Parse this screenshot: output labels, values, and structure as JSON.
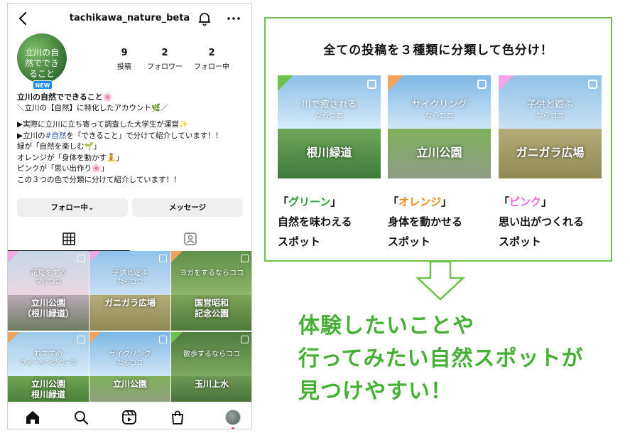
{
  "profile": {
    "username": "tachikawa_nature_beta",
    "avatar_text": "立川の自然でできること",
    "new_badge": "NEW",
    "stats": [
      {
        "num": "9",
        "label": "投稿"
      },
      {
        "num": "2",
        "label": "フォロワー"
      },
      {
        "num": "2",
        "label": "フォロー中"
      }
    ],
    "bio": {
      "name": "立川の自然でできること🌸",
      "line1": "＼立川の【自然】に特化したアカウント🌿／",
      "line2": "▶実際に立川に立ち寄って調査した大学生が運営✨",
      "line3_pre": "▶立川の",
      "line3_hash": "#自然",
      "line3_post": "を「できること」で分けて紹介しています！！",
      "line4": "緑が「自然を楽しむ🌱」",
      "line5": "オレンジが「身体を動かす🧘」",
      "line6": "ピンクが「思い出作り🌸」",
      "line7": "この３つの色で分類に分けて紹介しています！！"
    },
    "follow_button": "フォロー中⌄",
    "message_button": "メッセージ"
  },
  "posts": [
    {
      "title": "花見をする",
      "sub": "ならココ",
      "place": "立川公園",
      "place2": "（根川緑道）",
      "tag": "pink"
    },
    {
      "title": "子供と遊ぶ",
      "sub": "ならココ",
      "place": "ガニガラ広場",
      "place2": "",
      "tag": "pink"
    },
    {
      "title": "ヨガをするならココ",
      "sub": "",
      "place": "国営昭和",
      "place2": "記念公園",
      "tag": "orange"
    },
    {
      "title": "おすすめ",
      "sub": "ウォーキングコース",
      "place": "立川公園",
      "place2": "根川緑道",
      "tag": "orange"
    },
    {
      "title": "サイクリング",
      "sub": "ならココ",
      "place": "立川公園",
      "place2": "",
      "tag": "orange"
    },
    {
      "title": "散歩するならココ",
      "sub": "",
      "place": "玉川上水",
      "place2": "",
      "tag": "green"
    }
  ],
  "legend": {
    "title": "全ての投稿を３種類に分類して色分け！",
    "cards": [
      {
        "title": "川で癒される",
        "sub": "ならココ",
        "place": "根川緑道",
        "tag": "green"
      },
      {
        "title": "サイクリング",
        "sub": "ならココ",
        "place": "立川公園",
        "tag": "orange"
      },
      {
        "title": "子供と遊ぶ",
        "sub": "ならココ",
        "place": "ガニガラ広場",
        "tag": "pink"
      }
    ],
    "categories": [
      {
        "open": "「",
        "name": "グリーン",
        "close": "」",
        "line1": "自然を味わえる",
        "line2": "スポット",
        "color": "#2e9e3f"
      },
      {
        "open": "「",
        "name": "オレンジ",
        "close": "」",
        "line1": "身体を動かせる",
        "line2": "スポット",
        "color": "#f08a1c"
      },
      {
        "open": "「",
        "name": "ピンク",
        "close": "」",
        "line1": "思い出がつくれる",
        "line2": "スポット",
        "color": "#e96ad2"
      }
    ]
  },
  "tagline": {
    "line1": "体験したいことや",
    "line2": "行ってみたい自然スポットが",
    "line3": "見つけやすい！"
  },
  "colors": {
    "green": "#6cc24a",
    "orange": "#f5a25c",
    "pink": "#f3a6e6",
    "accent_blue": "#1b8be8"
  },
  "icons": [
    "back-arrow-icon",
    "bell-icon",
    "more-icon",
    "grid-icon",
    "tagged-icon",
    "home-icon",
    "search-icon",
    "reels-icon",
    "shop-icon"
  ]
}
